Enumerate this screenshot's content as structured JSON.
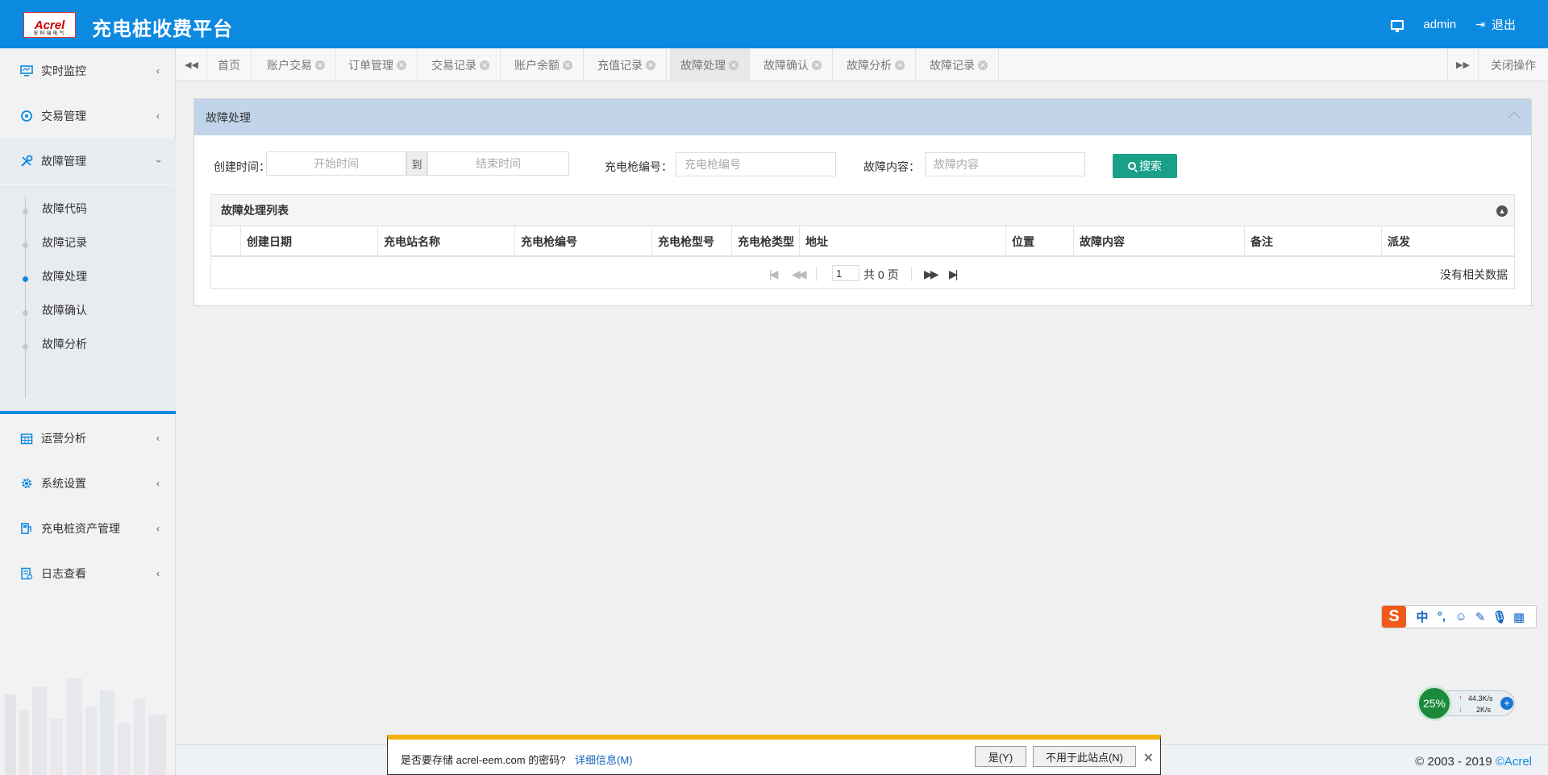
{
  "header": {
    "logo_text": "Acrel",
    "logo_sub": "安科瑞电气",
    "title": "充电桩收费平台",
    "user": "admin",
    "logout": "退出"
  },
  "sidebar": {
    "items": [
      {
        "label": "实时监控",
        "icon": "monitor-icon"
      },
      {
        "label": "交易管理",
        "icon": "refresh-icon"
      },
      {
        "label": "故障管理",
        "icon": "wrench-icon"
      },
      {
        "label": "运营分析",
        "icon": "calendar-icon"
      },
      {
        "label": "系统设置",
        "icon": "gear-icon"
      },
      {
        "label": "充电桩资产管理",
        "icon": "charger-icon"
      },
      {
        "label": "日志查看",
        "icon": "log-icon"
      }
    ],
    "submenu": [
      {
        "label": "故障代码"
      },
      {
        "label": "故障记录"
      },
      {
        "label": "故障处理"
      },
      {
        "label": "故障确认"
      },
      {
        "label": "故障分析"
      }
    ],
    "active_sub": "故障处理"
  },
  "tabs": {
    "items": [
      {
        "label": "首页"
      },
      {
        "label": "账户交易"
      },
      {
        "label": "订单管理"
      },
      {
        "label": "交易记录"
      },
      {
        "label": "账户余额"
      },
      {
        "label": "充值记录"
      },
      {
        "label": "故障处理"
      },
      {
        "label": "故障确认"
      },
      {
        "label": "故障分析"
      },
      {
        "label": "故障记录"
      }
    ],
    "active": "故障处理",
    "close_ops": "关闭操作"
  },
  "panel": {
    "title": "故障处理",
    "search": {
      "create_time_label": "创建时间：",
      "start_placeholder": "开始时间",
      "to": "到",
      "end_placeholder": "结束时间",
      "gun_no_label": "充电枪编号：",
      "gun_no_placeholder": "充电枪编号",
      "fault_label": "故障内容：",
      "fault_placeholder": "故障内容",
      "search_button": "搜索"
    },
    "list_title": "故障处理列表",
    "columns": [
      "创建日期",
      "充电站名称",
      "充电枪编号",
      "充电枪型号",
      "充电枪类型",
      "地址",
      "位置",
      "故障内容",
      "备注",
      "派发"
    ],
    "pager": {
      "page": "1",
      "total_text": "共 0 页",
      "no_data": "没有相关数据"
    }
  },
  "footer": {
    "copyright": "© 2003 - 2019 ",
    "brand": "©Acrel"
  },
  "password_bar": {
    "question": "是否要存储 acrel-eem.com 的密码?",
    "details": "详细信息(M)",
    "yes": "是(Y)",
    "never": "不用于此站点(N)"
  },
  "ime": {
    "logo": "S",
    "mode": "中",
    "punct": "°,"
  },
  "net_widget": {
    "percent": "25%",
    "up": "44.3K/s",
    "down": "2K/s"
  }
}
